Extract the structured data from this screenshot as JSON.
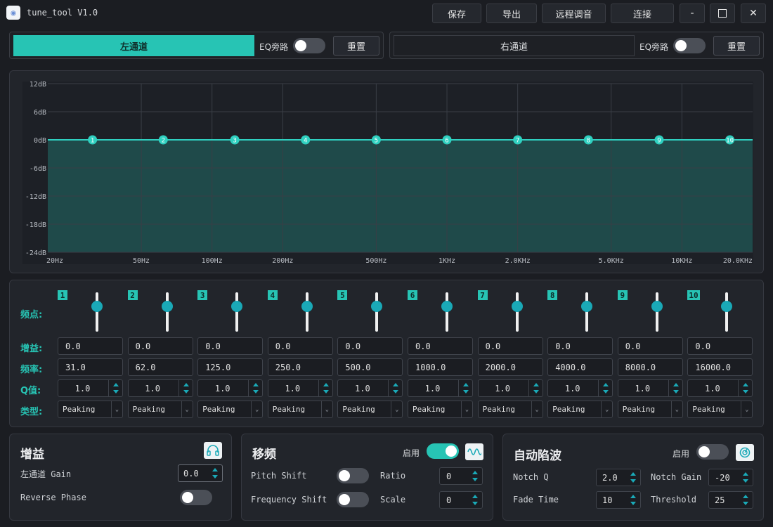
{
  "app": {
    "title": "tune_tool  V1.0",
    "icon": "app-logo-icon"
  },
  "toolbar": {
    "save": "保存",
    "export": "导出",
    "remote": "远程调音",
    "connect": "连接",
    "minimize": "-",
    "maximize": "☐",
    "close": "✕"
  },
  "left_channel": {
    "tab": "左通道",
    "bypass_label": "EQ旁路",
    "bypass_on": false,
    "reset": "重置"
  },
  "right_channel": {
    "tab": "右通道",
    "bypass_label": "EQ旁路",
    "bypass_on": false,
    "reset": "重置"
  },
  "chart_data": {
    "type": "line",
    "y_ticks": [
      "12dB",
      "6dB",
      "0dB",
      "-6dB",
      "-12dB",
      "-18dB",
      "-24dB"
    ],
    "ylim": [
      -24,
      12
    ],
    "x_ticks": [
      "20Hz",
      "50Hz",
      "100Hz",
      "200Hz",
      "500Hz",
      "1KHz",
      "2.0KHz",
      "5.0KHz",
      "10KHz",
      "20.0KHz"
    ],
    "x_tick_values": [
      20,
      50,
      100,
      200,
      500,
      1000,
      2000,
      5000,
      10000,
      20000
    ],
    "x_scale": "log",
    "xlim": [
      20,
      20000
    ],
    "grid": true,
    "curve_gain_db": 0,
    "points": [
      {
        "label": "1",
        "freq": 31,
        "gain": 0
      },
      {
        "label": "2",
        "freq": 62,
        "gain": 0
      },
      {
        "label": "3",
        "freq": 125,
        "gain": 0
      },
      {
        "label": "4",
        "freq": 250,
        "gain": 0
      },
      {
        "label": "5",
        "freq": 500,
        "gain": 0
      },
      {
        "label": "6",
        "freq": 1000,
        "gain": 0
      },
      {
        "label": "7",
        "freq": 2000,
        "gain": 0
      },
      {
        "label": "8",
        "freq": 4000,
        "gain": 0
      },
      {
        "label": "9",
        "freq": 8000,
        "gain": 0
      },
      {
        "label": "10",
        "freq": 16000,
        "gain": 0
      }
    ],
    "colors": {
      "line": "#2fd0c0",
      "fill": "#1f4a4a",
      "point": "#2fd0c0"
    }
  },
  "bands": {
    "row_labels": {
      "point": "频点:",
      "gain": "增益:",
      "freq": "频率:",
      "q": "Q值:",
      "type": "类型:"
    },
    "items": [
      {
        "num": "1",
        "gain": "0.0",
        "freq": "31.0",
        "q": "1.0",
        "type": "Peaking"
      },
      {
        "num": "2",
        "gain": "0.0",
        "freq": "62.0",
        "q": "1.0",
        "type": "Peaking"
      },
      {
        "num": "3",
        "gain": "0.0",
        "freq": "125.0",
        "q": "1.0",
        "type": "Peaking"
      },
      {
        "num": "4",
        "gain": "0.0",
        "freq": "250.0",
        "q": "1.0",
        "type": "Peaking"
      },
      {
        "num": "5",
        "gain": "0.0",
        "freq": "500.0",
        "q": "1.0",
        "type": "Peaking"
      },
      {
        "num": "6",
        "gain": "0.0",
        "freq": "1000.0",
        "q": "1.0",
        "type": "Peaking"
      },
      {
        "num": "7",
        "gain": "0.0",
        "freq": "2000.0",
        "q": "1.0",
        "type": "Peaking"
      },
      {
        "num": "8",
        "gain": "0.0",
        "freq": "4000.0",
        "q": "1.0",
        "type": "Peaking"
      },
      {
        "num": "9",
        "gain": "0.0",
        "freq": "8000.0",
        "q": "1.0",
        "type": "Peaking"
      },
      {
        "num": "10",
        "gain": "0.0",
        "freq": "16000.0",
        "q": "1.0",
        "type": "Peaking"
      }
    ]
  },
  "gain_panel": {
    "title": "增益",
    "icon": "headphones-icon",
    "left_gain_label": "左通道 Gain",
    "left_gain_value": "0.0",
    "reverse_phase_label": "Reverse Phase",
    "reverse_phase_on": false
  },
  "shift_panel": {
    "title": "移频",
    "enable_label": "启用",
    "enabled": true,
    "icon": "wave-icon",
    "pitch_shift_label": "Pitch Shift",
    "pitch_shift_on": false,
    "ratio_label": "Ratio",
    "ratio_value": "0",
    "freq_shift_label": "Frequency Shift",
    "freq_shift_on": false,
    "scale_label": "Scale",
    "scale_value": "0"
  },
  "notch_panel": {
    "title": "自动陷波",
    "enable_label": "启用",
    "enabled": false,
    "icon": "notch-icon",
    "notch_q_label": "Notch Q",
    "notch_q_value": "2.0",
    "notch_gain_label": "Notch Gain",
    "notch_gain_value": "-20",
    "fade_time_label": "Fade Time",
    "fade_time_value": "10",
    "threshold_label": "Threshold",
    "threshold_value": "25"
  }
}
